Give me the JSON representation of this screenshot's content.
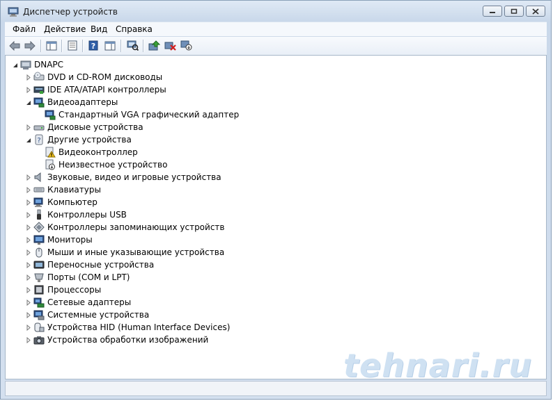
{
  "window": {
    "title": "Диспетчер устройств"
  },
  "menu": [
    "Файл",
    "Действие",
    "Вид",
    "Справка"
  ],
  "tree": {
    "root": "DNAPC",
    "items": [
      {
        "label": "DVD и CD-ROM дисководы",
        "expanded": false,
        "icon": "dvd-drive-icon"
      },
      {
        "label": "IDE ATA/ATAPI контроллеры",
        "expanded": false,
        "icon": "ide-controller-icon"
      },
      {
        "label": "Видеоадаптеры",
        "expanded": true,
        "icon": "display-adapter-icon",
        "children": [
          {
            "label": "Стандартный VGA графический адаптер",
            "icon": "display-adapter-icon"
          }
        ]
      },
      {
        "label": "Дисковые устройства",
        "expanded": false,
        "icon": "disk-drive-icon"
      },
      {
        "label": "Другие устройства",
        "expanded": true,
        "icon": "unknown-device-icon",
        "children": [
          {
            "label": "Видеоконтроллер",
            "icon": "warning-device-icon"
          },
          {
            "label": "Неизвестное устройство",
            "icon": "unknown-disabled-device-icon"
          }
        ]
      },
      {
        "label": "Звуковые, видео и игровые устройства",
        "expanded": false,
        "icon": "speaker-icon"
      },
      {
        "label": "Клавиатуры",
        "expanded": false,
        "icon": "keyboard-icon"
      },
      {
        "label": "Компьютер",
        "expanded": false,
        "icon": "computer-icon"
      },
      {
        "label": "Контроллеры USB",
        "expanded": false,
        "icon": "usb-icon"
      },
      {
        "label": "Контроллеры запоминающих устройств",
        "expanded": false,
        "icon": "storage-controller-icon"
      },
      {
        "label": "Мониторы",
        "expanded": false,
        "icon": "monitor-icon"
      },
      {
        "label": "Мыши и иные указывающие устройства",
        "expanded": false,
        "icon": "mouse-icon"
      },
      {
        "label": "Переносные устройства",
        "expanded": false,
        "icon": "portable-device-icon"
      },
      {
        "label": "Порты (COM и LPT)",
        "expanded": false,
        "icon": "port-icon"
      },
      {
        "label": "Процессоры",
        "expanded": false,
        "icon": "processor-icon"
      },
      {
        "label": "Сетевые адаптеры",
        "expanded": false,
        "icon": "network-adapter-icon"
      },
      {
        "label": "Системные устройства",
        "expanded": false,
        "icon": "system-device-icon"
      },
      {
        "label": "Устройства HID (Human Interface Devices)",
        "expanded": false,
        "icon": "hid-icon"
      },
      {
        "label": "Устройства обработки изображений",
        "expanded": false,
        "icon": "camera-icon"
      }
    ]
  },
  "watermark": "tehnari.ru"
}
